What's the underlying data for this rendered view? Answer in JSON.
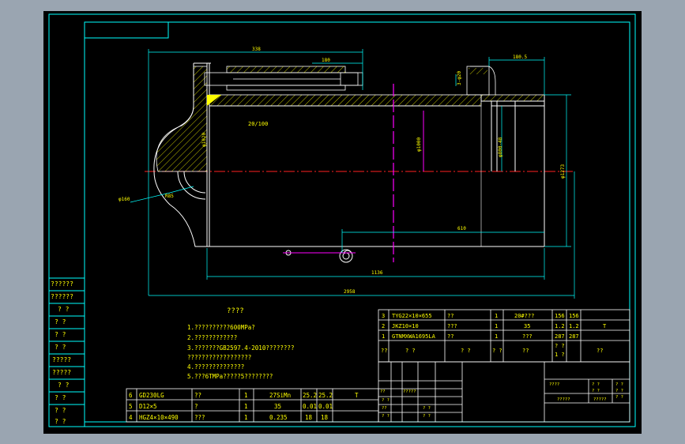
{
  "dimensions": {
    "top_338": "338",
    "top_180": "180",
    "right_180_5": "180.5",
    "ratio_20_100": "20/100",
    "phi1000": "φ1000",
    "phi800": "φ800-48",
    "phi1273": "φ1273",
    "r160": "φ160",
    "r85": "R85",
    "phi1020": "φ1020",
    "d610": "610",
    "d1136": "1136",
    "d1600": "1600",
    "d2958": "2958",
    "small_a": "3-φ20"
  },
  "notes": {
    "title": "????",
    "lines": [
      "1.??????????600MPa?",
      "2.????????????",
      "3.???????GB2597.4-2010????????",
      "  ??????????????????",
      "4.??????????????",
      "5.???6TMPa?????5????????"
    ]
  },
  "left_column": [
    "??????",
    "??????",
    "? ?",
    "? ?",
    "? ?",
    "? ?",
    "?????",
    "?????",
    "? ?",
    "? ?",
    "? ?",
    "? ?"
  ],
  "parts_top": [
    {
      "no": "3",
      "code": "TYG22×10×655",
      "name": "??",
      "qty": "1",
      "mat": "20#???",
      "w1": "156",
      "w2": "156",
      "note": ""
    },
    {
      "no": "2",
      "code": "JKZ10×10",
      "name": "???",
      "qty": "1",
      "mat": "35",
      "w1": "1.2",
      "w2": "1.2",
      "note": "T"
    },
    {
      "no": "1",
      "code": "GTNMXWA1695LA",
      "name": "??",
      "qty": "1",
      "mat": "???",
      "w1": "287",
      "w2": "287",
      "note": ""
    }
  ],
  "parts_top_header": [
    "??",
    "? ?",
    "? ?",
    "? ?",
    "??",
    "? ?",
    "1 ?",
    "? ?",
    "??"
  ],
  "parts_bottom": [
    {
      "no": "6",
      "code": "GD230LG",
      "name": "??",
      "qty": "1",
      "mat": "27SiMn",
      "w1": "25.2",
      "w2": "25.2",
      "note": "T"
    },
    {
      "no": "5",
      "code": "D12×5",
      "name": "?",
      "qty": "1",
      "mat": "35",
      "w1": "0.01",
      "w2": "0.01",
      "note": ""
    },
    {
      "no": "4",
      "code": "HGZ4×10×490",
      "name": "???",
      "qty": "1",
      "mat": "0.235",
      "w1": "18",
      "w2": "18",
      "note": ""
    }
  ],
  "title_block": {
    "cells": [
      "??",
      "?????",
      "? ?",
      "??",
      "? ?",
      "? ?",
      "? ?"
    ],
    "right_cells": [
      "????",
      "? ?",
      "? ?",
      "? ?",
      "? ?",
      "? ?",
      "?????",
      "?????"
    ]
  },
  "colors": {
    "bg": "#000000",
    "frame": "#00ffff",
    "geometry": "#ffffff",
    "hatch": "#ffff00",
    "center": "#ff2020",
    "dim": "#ff00ff",
    "text": "#ffff00"
  }
}
